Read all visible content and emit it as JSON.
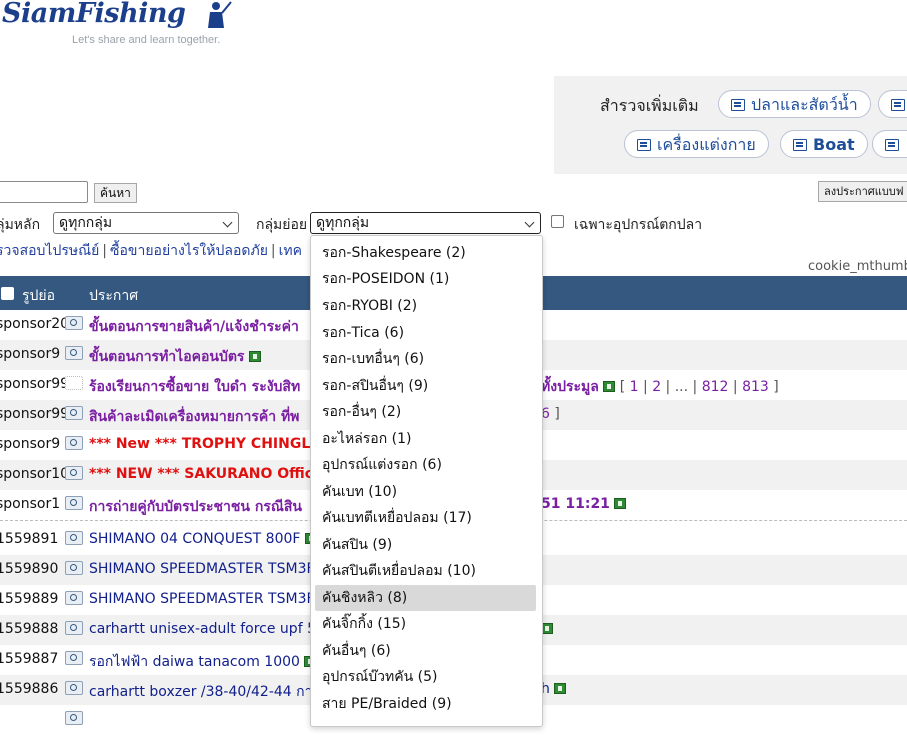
{
  "logo": {
    "brand": "SiamFishing",
    "tagline": "Let's share and learn together."
  },
  "explore": {
    "title": "สำรวจเพิ่มเติม",
    "pills": [
      "ปลาและสัตว์น้ำ",
      "เครื่องแต่งกาย",
      "Boat"
    ]
  },
  "search": {
    "button_label": "ค้นหา",
    "value": ""
  },
  "post_button_label": "ลงประกาศแบบฟ",
  "filters": {
    "main_group_label": "ลุ่มหลัก",
    "main_group_value": "ดูทุกกลุ่ม",
    "sub_group_label": "กลุ่มย่อย",
    "sub_group_value": "ดูทุกกลุ่ม",
    "fishing_only_label": "เฉพาะอุปกรณ์ตกปลา"
  },
  "links": {
    "verify": "รวจสอบไปรษณีย์",
    "safe_buy": "ซื้อขายอย่างไรให้ปลอดภัย",
    "tech": "เทค"
  },
  "cookie_text": "cookie_mthumb",
  "table": {
    "headers": {
      "photo": "รูปย่อ",
      "post": "ประกาศ"
    },
    "rows": [
      {
        "id": "sponsor20",
        "title": "ขั้นตอนการขายสินค้า/แจ้งชำระค่า"
      },
      {
        "id": "sponsor9",
        "title": "ขั้นตอนการทำไอคอนบัตร"
      },
      {
        "id": "sponsor99",
        "title": "ร้องเรียนการซื้อขาย ใบดำ ระงับสิท",
        "tail": "ทั้งประมูล",
        "pages": [
          "1",
          "2",
          "...",
          "812",
          "813"
        ]
      },
      {
        "id": "sponsor99",
        "title": "สินค้าละเมิดเครื่องหมายการค้า ที่พ",
        "tail_page": "6"
      },
      {
        "id": "sponsor9",
        "title": "*** New *** TROPHY CHINGLI"
      },
      {
        "id": "sponsor10",
        "title": "*** NEW *** SAKURANO Offici"
      },
      {
        "id": "sponsor1",
        "title": "การถ่ายคู่กับบัตรประชาชน กรณีสิน",
        "tail": "51 11:21"
      },
      {
        "id": "1559891",
        "title": "SHIMANO 04 CONQUEST 800F"
      },
      {
        "id": "1559890",
        "title": "SHIMANO SPEEDMASTER TSM3FS ("
      },
      {
        "id": "1559889",
        "title": "SHIMANO SPEEDMASTER TSM3FS ("
      },
      {
        "id": "1559888",
        "title": "carhartt unisex-adult force upf 50+"
      },
      {
        "id": "1559887",
        "title": "รอกไฟฟ้า daiwa tanacom 1000"
      },
      {
        "id": "1559886",
        "title": "carhartt boxzer /38-40/42-44 กางเก",
        "tail": "h"
      }
    ]
  },
  "dropdown": {
    "options": [
      "รอก-Shakespeare (2)",
      "รอก-POSEIDON (1)",
      "รอก-RYOBI (2)",
      "รอก-Tica (6)",
      "รอก-เบทอื่นๆ (6)",
      "รอก-สปินอื่นๆ (9)",
      "รอก-อื่นๆ (2)",
      "อะไหล่รอก (1)",
      "อุปกรณ์แต่งรอก (6)",
      "คันเบท (10)",
      "คันเบทตีเหยื่อปลอม (17)",
      "คันสปิน (9)",
      "คันสปินตีเหยื่อปลอม (10)",
      "คันชิงหลิว (8)",
      "คันจิ๊กกิ้ง (15)",
      "คันอื่นๆ (6)",
      "อุปกรณ์บ๊วทคัน (5)",
      "สาย PE/Braided (9)"
    ],
    "highlighted": "คันชิงหลิว (8)"
  },
  "colors": {
    "header_bg": "#34587f",
    "sponsor_text": "#7a1fa2",
    "link_blue": "#12208c",
    "new_red": "#e01010"
  }
}
